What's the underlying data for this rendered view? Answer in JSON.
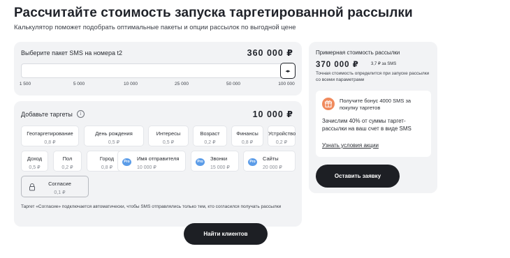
{
  "header": {
    "title": "Рассчитайте стоимость запуска таргетированной рассылки",
    "subtitle": "Калькулятор поможет подобрать оптимальные пакеты и опции рассылок по выгодной цене"
  },
  "package": {
    "label": "Выберите пакет SMS на номера t2",
    "price": "360 000 ₽",
    "slider_value_fraction": 1.0,
    "thumb_glyph": "◂▸",
    "ticks": [
      "1 500",
      "5 000",
      "10 000",
      "25 000",
      "50 000",
      "100 000"
    ]
  },
  "targets": {
    "label": "Добавьте таргеты",
    "info_glyph": "i",
    "price": "10 000 ₽",
    "chips": [
      {
        "name": "Геотаргетирование",
        "price": "0,8 ₽"
      },
      {
        "name": "День рождения",
        "price": "0,5 ₽"
      },
      {
        "name": "Интересы",
        "price": "0,5 ₽"
      },
      {
        "name": "Возраст",
        "price": "0,2 ₽"
      },
      {
        "name": "Финансы",
        "price": "0,8 ₽"
      },
      {
        "name": "Устройство",
        "price": "0,2 ₽"
      },
      {
        "name": "Доход",
        "price": "0,5 ₽"
      },
      {
        "name": "Пол",
        "price": "0,2 ₽"
      },
      {
        "name": "Город",
        "price": "0,8 ₽"
      },
      {
        "name": "Имя отправителя",
        "price": "10 000 ₽",
        "badge": "Pro"
      },
      {
        "name": "Звонки",
        "price": "15 000 ₽",
        "badge": "Pro"
      },
      {
        "name": "Сайты",
        "price": "20 000 ₽",
        "badge": "Pro"
      },
      {
        "name": "Согласие",
        "price": "0,1 ₽",
        "locked": true
      }
    ],
    "footnote": "Таргет «Согласие» подключается автоматически, чтобы SMS отправлялись только тем, кто согласился получать рассылки"
  },
  "find_button": "Найти клиентов",
  "summary": {
    "label": "Примерная стоимость рассылки",
    "price": "370 000 ₽",
    "per_sms": "3,7 ₽ за SMS",
    "note": "Точная стоимость определится при запуске рассылки со всеми параметрами",
    "bonus": {
      "title": "Получите бонус 4000 SMS за покупку таргетов",
      "text": "Зачислим 40% от суммы таргет-рассылки на ваш счет в виде SMS",
      "link": "Узнать условия акции"
    },
    "submit_button": "Оставить заявку"
  },
  "colors": {
    "accent_dark": "#1d1f24",
    "card_bg": "#f2f3f5",
    "pro_badge": "#5b9ce8",
    "gift_icon": "#f08a5d"
  },
  "icons": [
    "info-icon",
    "slider-arrows-icon",
    "pro-badge-icon",
    "lock-icon",
    "gift-icon"
  ]
}
